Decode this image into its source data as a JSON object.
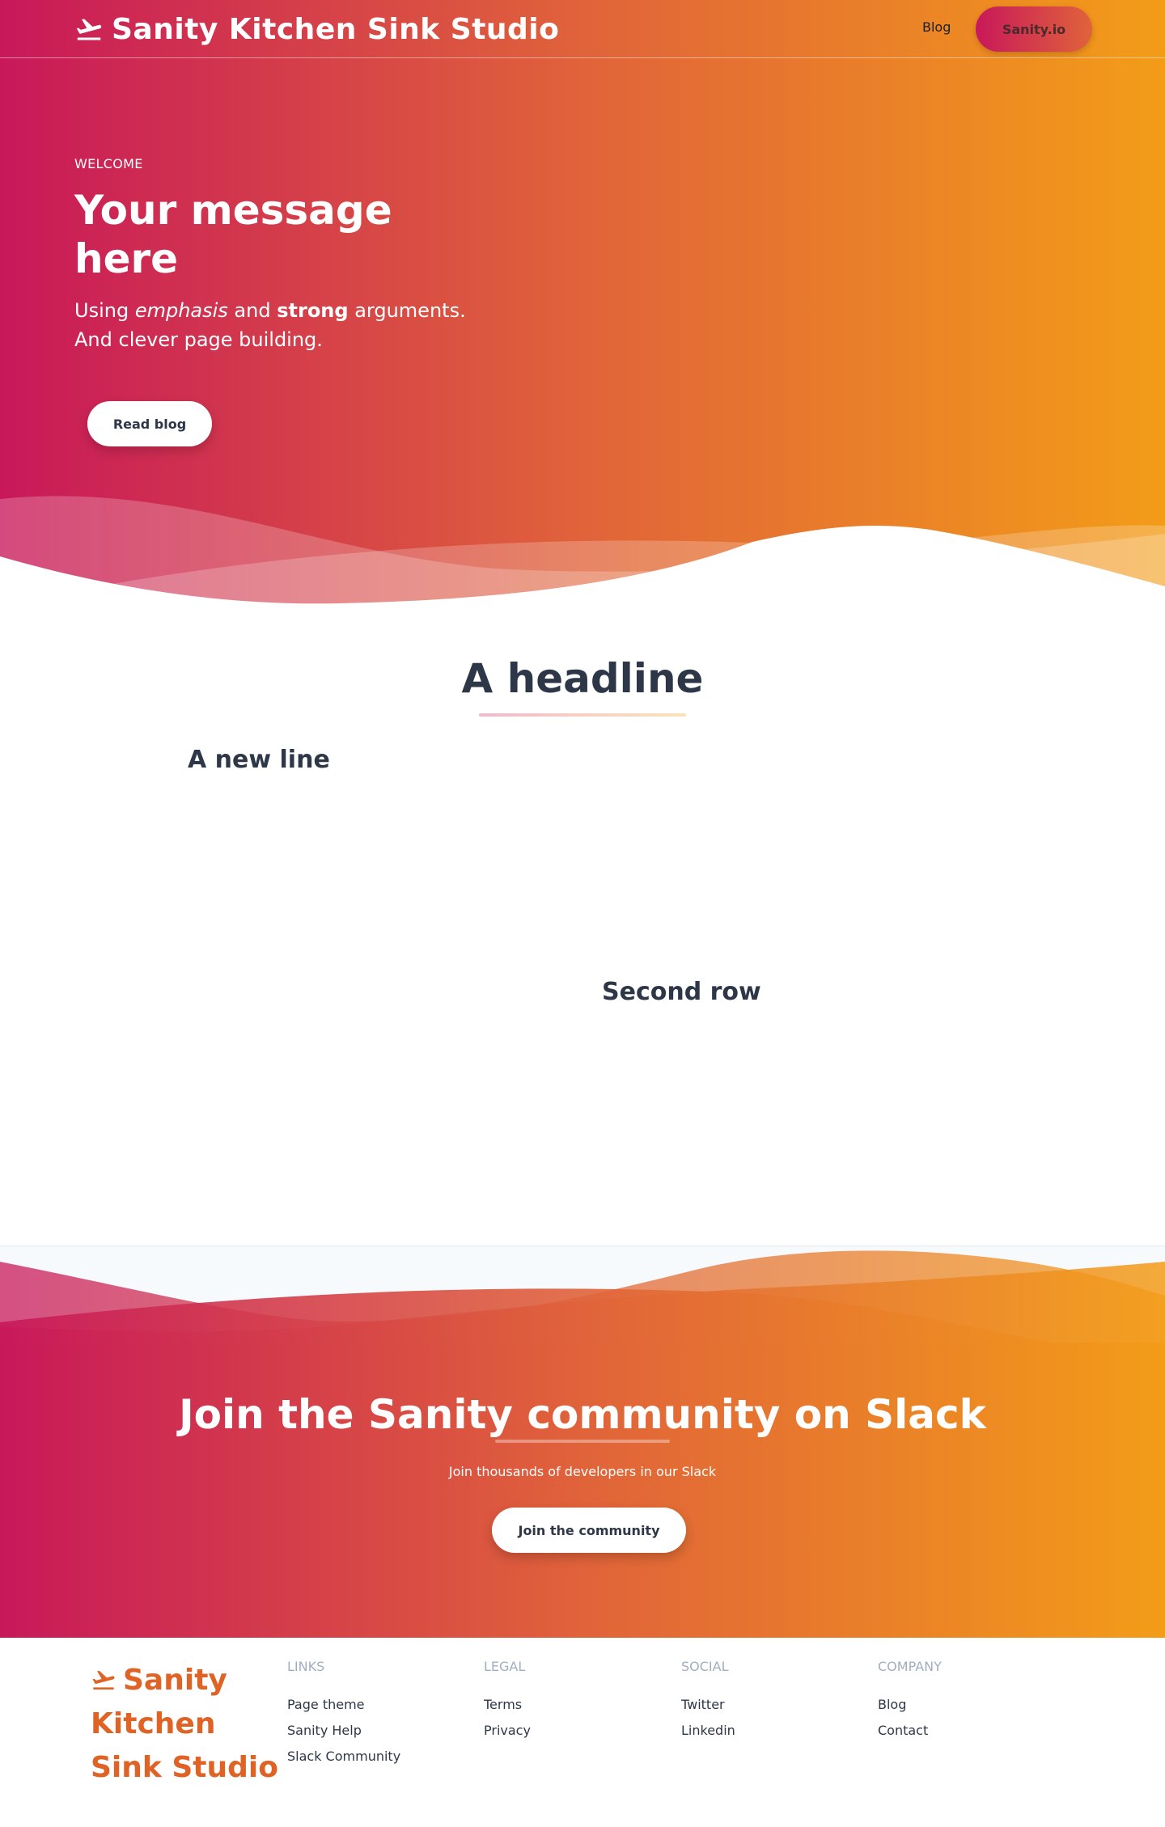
{
  "header": {
    "brand_name": "Sanity Kitchen Sink Studio",
    "brand_icon": "plane-takeoff-icon",
    "nav_blog": "Blog",
    "nav_cta": "Sanity.io"
  },
  "hero": {
    "eyebrow": "WELCOME",
    "title": "Your message here",
    "subtitle_parts": [
      "Using ",
      "emphasis",
      " and ",
      "strong",
      " arguments."
    ],
    "subtitle_line2": "And clever page building.",
    "button_label": "Read blog"
  },
  "content": {
    "headline": "A headline",
    "new_line": "A new line",
    "second_row": "Second row"
  },
  "cta": {
    "title": "Join the Sanity community on Slack",
    "subtitle": "Join thousands of developers in our Slack",
    "button_label": "Join the community"
  },
  "footer": {
    "brand_name": "Sanity Kitchen Sink Studio",
    "columns": [
      {
        "title": "LINKS",
        "links": [
          "Page theme",
          "Sanity Help",
          "Slack Community"
        ]
      },
      {
        "title": "LEGAL",
        "links": [
          "Terms",
          "Privacy"
        ]
      },
      {
        "title": "SOCIAL",
        "links": [
          "Twitter",
          "Linkedin"
        ]
      },
      {
        "title": "COMPANY",
        "links": [
          "Blog",
          "Contact"
        ]
      }
    ]
  },
  "colors": {
    "gradient_start": "#c8185a",
    "gradient_mid": "#e0633a",
    "gradient_end": "#f39c18",
    "text_dark": "#2d3748",
    "footer_brand": "#e06326",
    "footer_heading": "#a0aec0"
  }
}
